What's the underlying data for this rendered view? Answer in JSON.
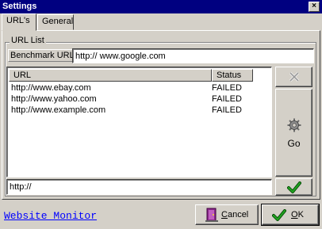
{
  "window": {
    "title": "Settings",
    "close_glyph": "×"
  },
  "tabs": [
    {
      "label": "URL's",
      "active": true
    },
    {
      "label": "General",
      "active": false
    }
  ],
  "url_list": {
    "group_label": "URL List",
    "benchmark_label": "Benchmark URL",
    "benchmark_value": "http:// www.google.com",
    "columns": [
      "URL",
      "Status"
    ],
    "rows": [
      {
        "url": "http://www.ebay.com",
        "status": "FAILED"
      },
      {
        "url": "http://www.yahoo.com",
        "status": "FAILED"
      },
      {
        "url": "http://www.example.com",
        "status": "FAILED"
      }
    ],
    "new_url_value": "http://"
  },
  "side_buttons": {
    "delete_icon": "x-icon",
    "go_label": "Go",
    "go_icon": "gear-icon",
    "add_icon": "checkmark-icon"
  },
  "footer": {
    "link_text": "Website Monitor",
    "cancel_label": "Cancel",
    "cancel_underline_char": "C",
    "cancel_rest": "ancel",
    "ok_label": "OK",
    "ok_underline_char": "O",
    "ok_rest": "K"
  },
  "colors": {
    "accent": "#000080",
    "check_green": "#008000",
    "link": "#0000ff"
  }
}
